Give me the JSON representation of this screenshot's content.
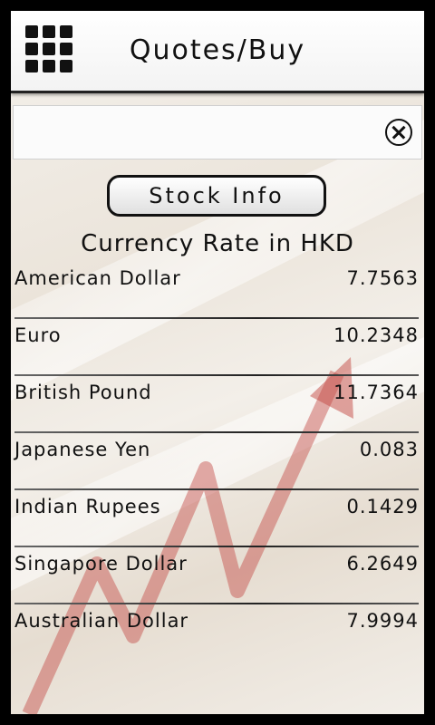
{
  "header": {
    "title": "Quotes/Buy",
    "menu_icon": "grid-menu-icon"
  },
  "search": {
    "value": "",
    "placeholder": "",
    "clear_icon": "circle-x-icon"
  },
  "stock_button": {
    "label": "Stock Info"
  },
  "rates_section": {
    "title": "Currency Rate in HKD",
    "rows": [
      {
        "name": "American Dollar",
        "value": "7.7563"
      },
      {
        "name": "Euro",
        "value": "10.2348"
      },
      {
        "name": "British Pound",
        "value": "11.7364"
      },
      {
        "name": "Japanese Yen",
        "value": "0.083"
      },
      {
        "name": "Indian Rupees",
        "value": "0.1429"
      },
      {
        "name": "Singapore Dollar",
        "value": "6.2649"
      },
      {
        "name": "Australian Dollar",
        "value": "7.9994"
      }
    ]
  },
  "colors": {
    "frame": "#000000",
    "text": "#111111",
    "arrow": "#c44a44"
  }
}
